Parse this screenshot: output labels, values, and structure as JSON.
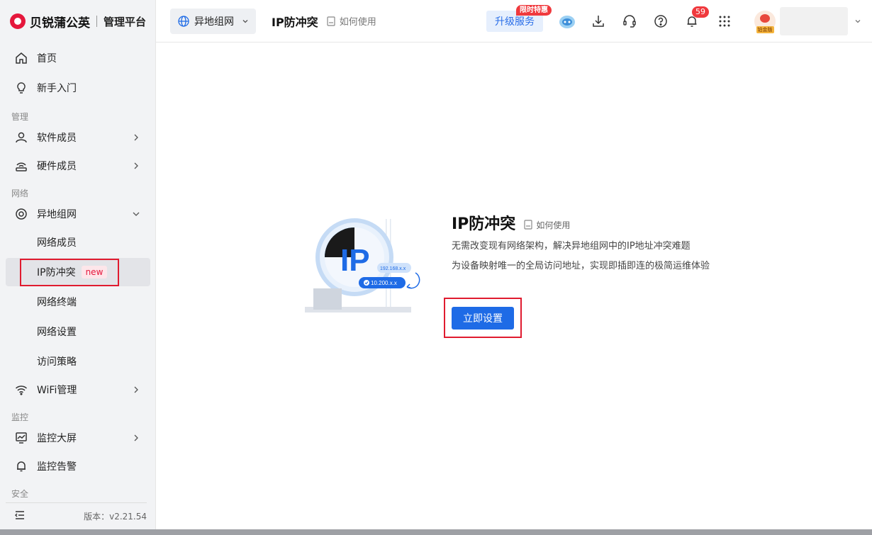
{
  "brand": {
    "name": "贝锐蒲公英",
    "subtitle": "管理平台"
  },
  "sidebar": {
    "items": [
      {
        "label": "首页",
        "icon": "home-icon"
      },
      {
        "label": "新手入门",
        "icon": "lightbulb-icon"
      }
    ],
    "sections": {
      "manage": "管理",
      "network": "网络",
      "monitor": "监控",
      "security": "安全"
    },
    "manage_items": [
      {
        "label": "软件成员",
        "icon": "user-icon"
      },
      {
        "label": "硬件成员",
        "icon": "router-icon"
      }
    ],
    "network_group": {
      "label": "异地组网",
      "icon": "network-ring-icon"
    },
    "network_sub": [
      {
        "label": "网络成员"
      },
      {
        "label": "IP防冲突",
        "badge": "new"
      },
      {
        "label": "网络终端"
      },
      {
        "label": "网络设置"
      },
      {
        "label": "访问策略"
      }
    ],
    "wifi": {
      "label": "WiFi管理",
      "icon": "wifi-icon"
    },
    "monitor_items": [
      {
        "label": "监控大屏",
        "icon": "monitor-chart-icon"
      },
      {
        "label": "监控告警",
        "icon": "bell-icon"
      }
    ],
    "version": "版本：v2.21.54"
  },
  "header": {
    "scope": "异地组网",
    "title": "IP防冲突",
    "doc_link": "如何使用",
    "upgrade_label": "升级服务",
    "promo_tag": "限时特惠",
    "notifications": "59",
    "tier_label": "铂金版"
  },
  "main": {
    "title": "IP防冲突",
    "doc_link": "如何使用",
    "desc_1": "无需改变现有网络架构，解决异地组网中的IP地址冲突难题",
    "desc_2": "为设备映射唯一的全局访问地址，实现即插即连的极简运维体验",
    "button": "立即设置",
    "illus_ip": "IP",
    "illus_ip_a": "192.168.x.x",
    "illus_ip_b": "10.200.x.x"
  },
  "colors": {
    "accent": "#1e6be6",
    "brand": "#e5173c",
    "highlight_box": "#e01b2f"
  }
}
